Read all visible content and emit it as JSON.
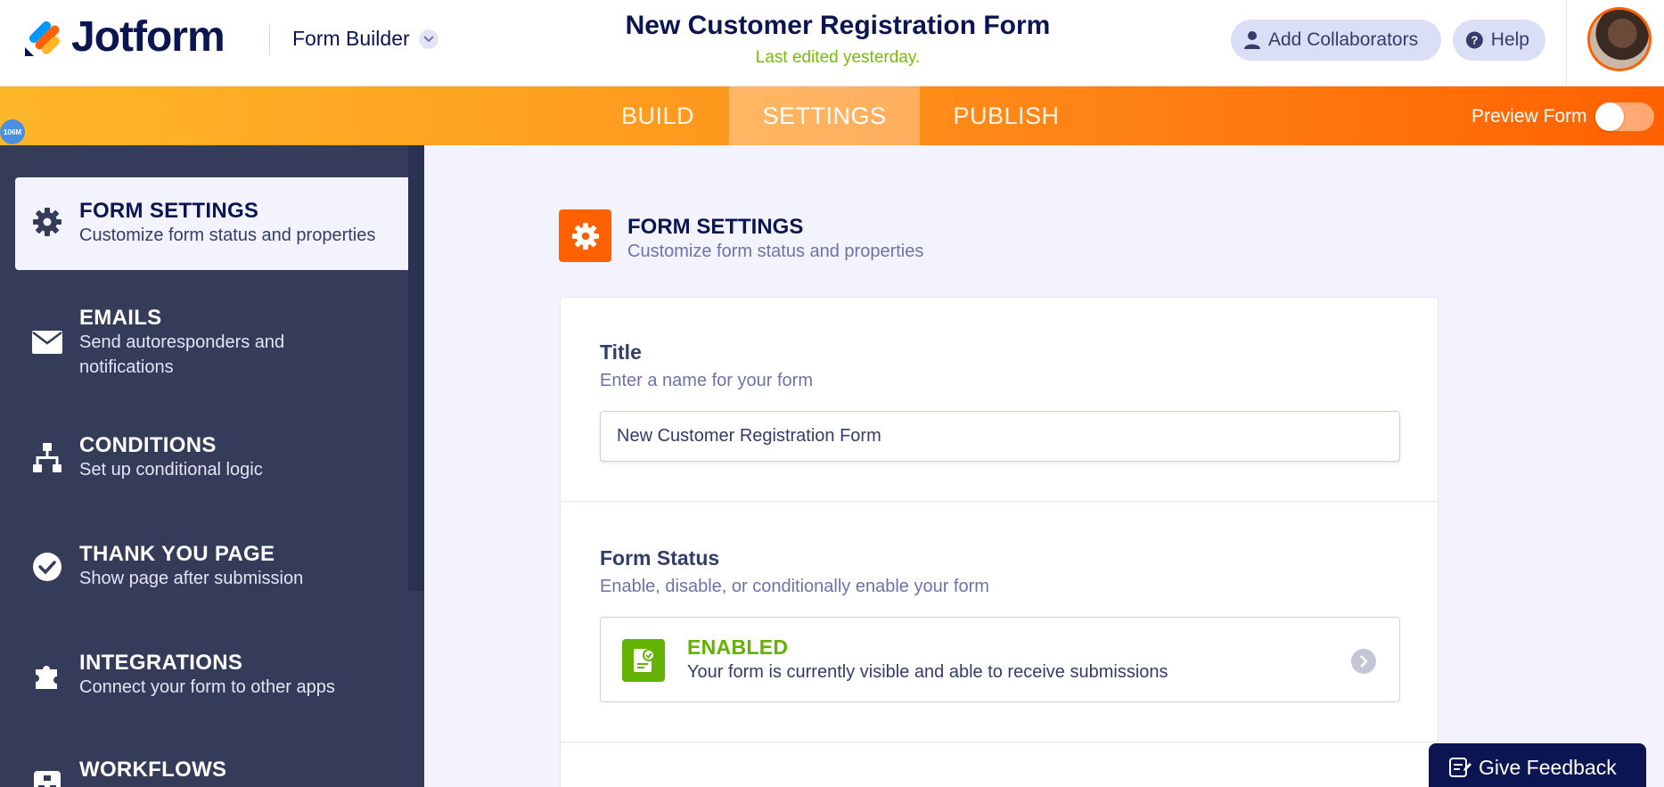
{
  "header": {
    "logo_text": "Jotform",
    "builder_label": "Form Builder",
    "form_title": "New Customer Registration Form",
    "last_edited": "Last edited yesterday.",
    "add_collaborators_label": "Add Collaborators",
    "help_label": "Help"
  },
  "tabs": [
    {
      "label": "BUILD",
      "active": false
    },
    {
      "label": "SETTINGS",
      "active": true
    },
    {
      "label": "PUBLISH",
      "active": false
    }
  ],
  "preview": {
    "label": "Preview Form",
    "enabled": false
  },
  "memory_badge": "106M",
  "sidebar": {
    "items": [
      {
        "title": "FORM SETTINGS",
        "desc": "Customize form status and properties",
        "icon": "gear-icon",
        "active": true
      },
      {
        "title": "EMAILS",
        "desc": "Send autoresponders and notifications",
        "icon": "envelope-icon",
        "active": false
      },
      {
        "title": "CONDITIONS",
        "desc": "Set up conditional logic",
        "icon": "sitemap-icon",
        "active": false
      },
      {
        "title": "THANK YOU PAGE",
        "desc": "Show page after submission",
        "icon": "check-circle-icon",
        "active": false
      },
      {
        "title": "INTEGRATIONS",
        "desc": "Connect your form to other apps",
        "icon": "puzzle-icon",
        "active": false
      },
      {
        "title": "WORKFLOWS",
        "desc": "",
        "icon": "workflow-icon",
        "active": false
      }
    ]
  },
  "main": {
    "title": "FORM SETTINGS",
    "desc": "Customize form status and properties",
    "title_field": {
      "label": "Title",
      "desc": "Enter a name for your form",
      "value": "New Customer Registration Form"
    },
    "status_field": {
      "label": "Form Status",
      "desc": "Enable, disable, or conditionally enable your form",
      "status": "ENABLED",
      "status_desc": "Your form is currently visible and able to receive submissions"
    }
  },
  "feedback_label": "Give Feedback",
  "colors": {
    "brand_navy": "#0a1551",
    "brand_orange": "#ff6100",
    "sidebar_bg": "#343c59",
    "enabled_green": "#64b200"
  }
}
